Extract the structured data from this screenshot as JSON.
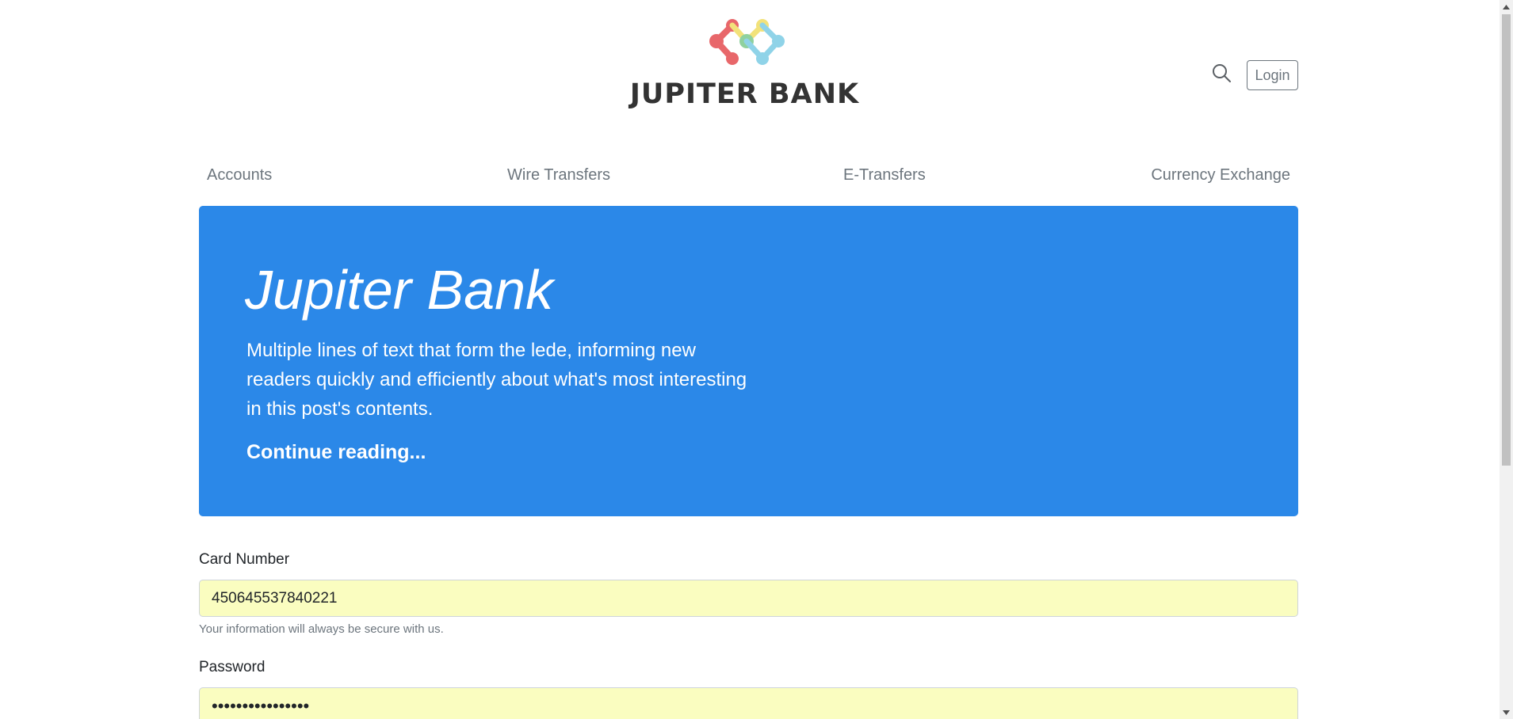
{
  "header": {
    "brand_name": "JUPITER BANK",
    "search_icon": "search-icon",
    "login_label": "Login"
  },
  "nav": {
    "items": [
      {
        "label": "Accounts"
      },
      {
        "label": "Wire Transfers"
      },
      {
        "label": "E-Transfers"
      },
      {
        "label": "Currency Exchange"
      }
    ]
  },
  "hero": {
    "title": "Jupiter Bank",
    "lede": "Multiple lines of text that form the lede, informing new readers quickly and efficiently about what's most interesting in this post's contents.",
    "link_label": "Continue reading...",
    "background_color": "#2b88e8"
  },
  "form": {
    "card_number": {
      "label": "Card Number",
      "value": "450645537840221",
      "help": "Your information will always be secure with us."
    },
    "password": {
      "label": "Password",
      "value": "••••••••••••••••"
    },
    "autofill_color": "#fafdc0"
  },
  "colors": {
    "accent": "#2b88e8",
    "muted_text": "#6c757d",
    "logo_red": "#e8676a",
    "logo_yellow": "#f2e27a",
    "logo_green": "#8fd19e",
    "logo_blue": "#8fd3e8"
  }
}
